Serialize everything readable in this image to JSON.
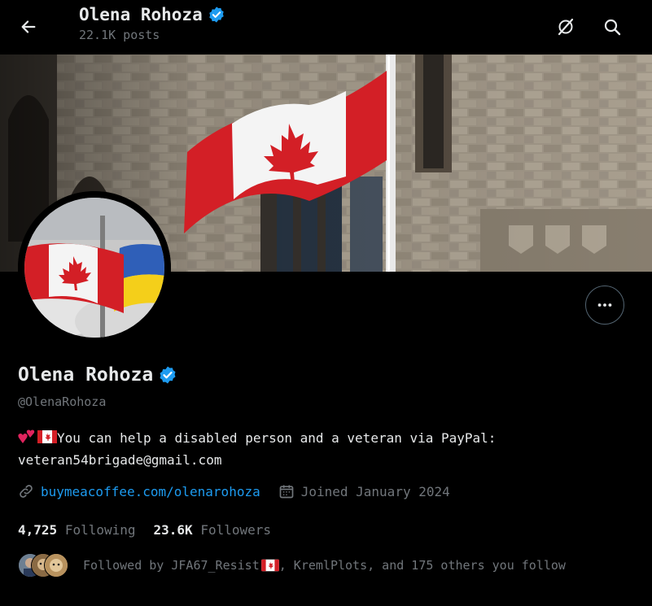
{
  "header": {
    "title": "Olena Rohoza",
    "posts_count": "22.1K posts",
    "back_icon": "arrow-left-icon",
    "grok_icon": "grok-icon",
    "search_icon": "search-icon"
  },
  "profile": {
    "display_name": "Olena Rohoza",
    "handle": "@OlenaRohoza",
    "verified": true,
    "bio_line1": "You can help a disabled person and a veteran via PayPal:",
    "bio_line2": "veteran54brigade@gmail.com",
    "website": "buymeacoffee.com/olenarohoza",
    "joined": "Joined January 2024",
    "following_count": "4,725",
    "following_label": "Following",
    "followers_count": "23.6K",
    "followers_label": "Followers",
    "followed_by": "Followed by JFA67_Resist",
    "followed_by_rest": ", KremlPlots, and 175 others you follow"
  },
  "colors": {
    "accent": "#1d9bf0",
    "muted": "#71767b",
    "text": "#e7e9ea",
    "background": "#000000"
  }
}
